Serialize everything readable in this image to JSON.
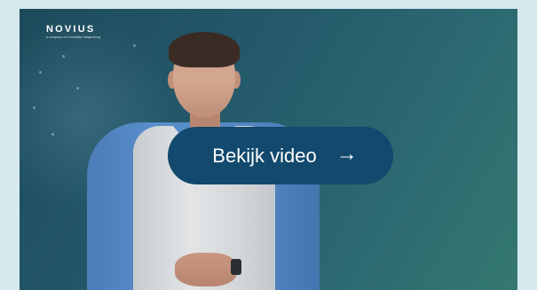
{
  "logo": {
    "text": "NOVIUS",
    "subtext": "a company of Koninklijke Wagenborg"
  },
  "cta": {
    "label": "Bekijk video",
    "icon": "arrow-right-icon"
  },
  "colors": {
    "page_background": "#d5e9ef",
    "button_background": "#12496c",
    "video_gradient_start": "#1d4b5c",
    "video_gradient_end": "#34796f"
  }
}
